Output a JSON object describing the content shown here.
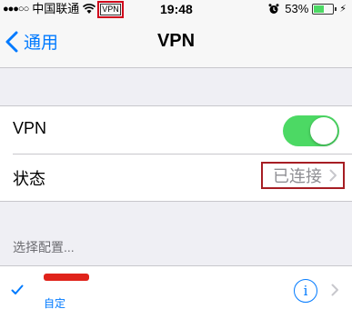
{
  "status_bar": {
    "signal": "●●●○○",
    "carrier": "中国联通",
    "vpn_badge": "VPN",
    "time": "19:48",
    "battery": "53%",
    "battery_level": 0.53
  },
  "nav": {
    "back_label": "通用",
    "title": "VPN"
  },
  "vpn_group": {
    "vpn_label": "VPN",
    "vpn_enabled": true,
    "status_label": "状态",
    "status_value": "已连接"
  },
  "config_section": {
    "header": "选择配置...",
    "items": [
      {
        "subtitle": "自定",
        "selected": true
      }
    ]
  },
  "colors": {
    "accent": "#007aff",
    "toggle_on": "#4cd964",
    "highlight_box": "#a61d23",
    "redaction": "#e0231a"
  }
}
